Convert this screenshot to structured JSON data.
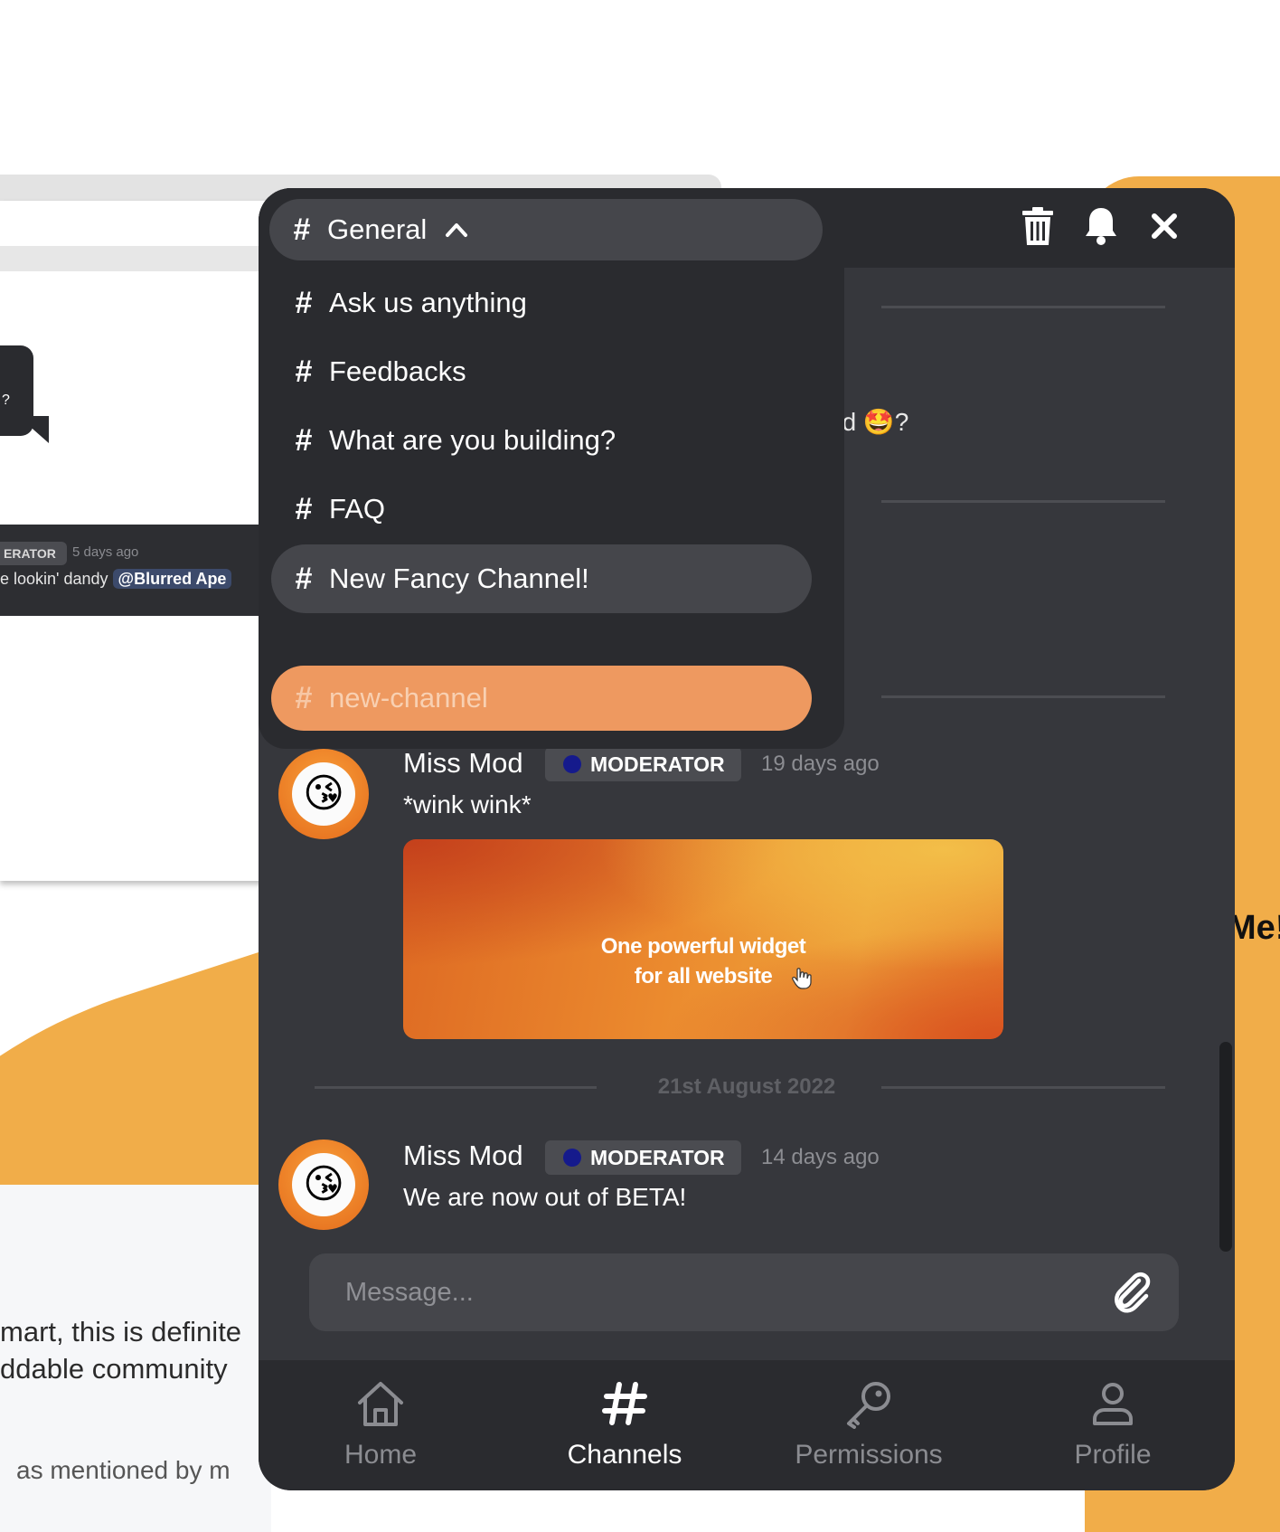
{
  "background": {
    "bubble_text": "?",
    "bg_message": {
      "badge": "ERATOR",
      "time": "5 days ago",
      "text": "e lookin' dandy",
      "mention": "@Blurred Ape"
    },
    "text_line_1": "mart, this is definite",
    "text_line_2": "ddable community",
    "text_line_3": "as mentioned by m",
    "right_text": "Me!"
  },
  "header": {
    "icons": [
      "trash-icon",
      "bell-icon",
      "close-icon"
    ]
  },
  "dropdown": {
    "current_channel": "General",
    "channels": [
      {
        "label": "Ask us anything"
      },
      {
        "label": "Feedbacks"
      },
      {
        "label": "What are you building?"
      },
      {
        "label": "FAQ"
      },
      {
        "label": "New Fancy Channel!"
      }
    ],
    "new_channel_placeholder": "new-channel"
  },
  "chat": {
    "partial_text": "ed 🤩?",
    "messages": [
      {
        "author": "Miss Mod",
        "role": "MODERATOR",
        "time": "19 days ago",
        "text": "*wink wink*",
        "avatar_emoji": "😘",
        "image_text_line_1": "One powerful widget",
        "image_text_line_2": "for all website"
      },
      {
        "author": "Miss Mod",
        "role": "MODERATOR",
        "time": "14 days ago",
        "text": "We are now out of BETA!",
        "avatar_emoji": "😘"
      }
    ],
    "date_separator": "21st August 2022"
  },
  "composer": {
    "placeholder": "Message..."
  },
  "nav": {
    "items": [
      {
        "label": "Home",
        "icon": "home-icon",
        "active": false
      },
      {
        "label": "Channels",
        "icon": "hash-icon",
        "active": true
      },
      {
        "label": "Permissions",
        "icon": "key-icon",
        "active": false
      },
      {
        "label": "Profile",
        "icon": "user-icon",
        "active": false
      }
    ]
  },
  "colors": {
    "widget_bg": "#36373c",
    "header_bg": "#2a2b2f",
    "accent_orange": "#ee9960",
    "moderator_dot": "#151a8c",
    "page_orange": "#f1ad49"
  }
}
